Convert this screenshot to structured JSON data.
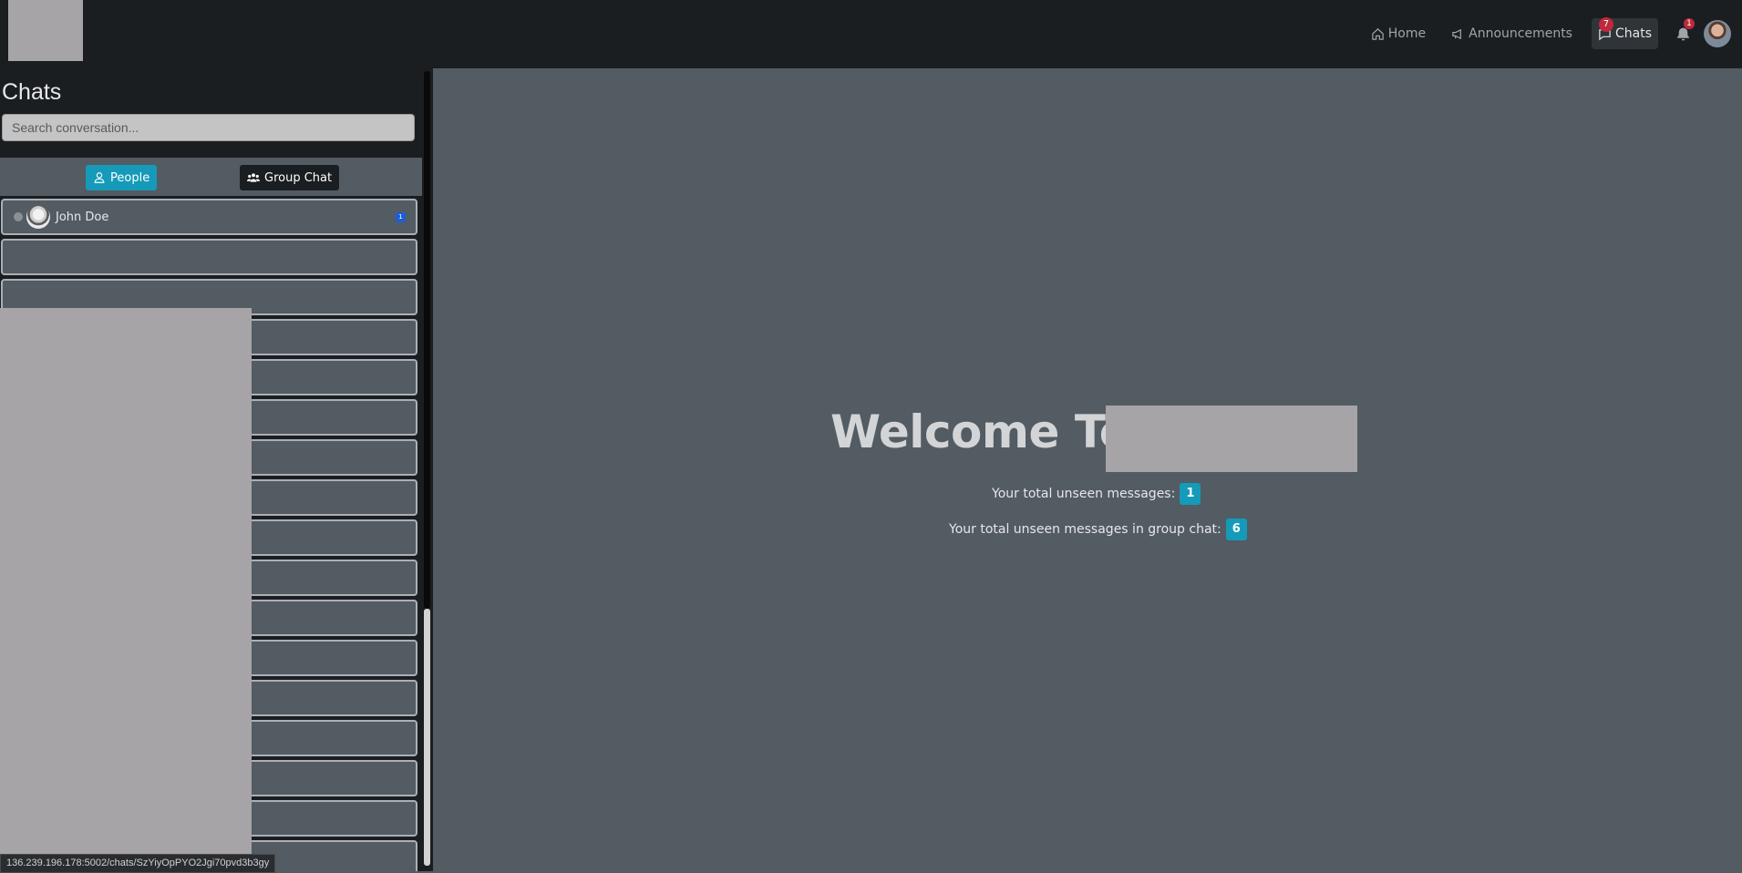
{
  "nav": {
    "home": "Home",
    "announcements": "Announcements",
    "chats": "Chats",
    "chats_badge": "7",
    "notifications_badge": "1"
  },
  "sidebar": {
    "title": "Chats",
    "search_placeholder": "Search conversation...",
    "tabs": {
      "people": "People",
      "group_chat": "Group Chat"
    },
    "contacts": [
      {
        "name": "John Doe",
        "unread": "1"
      }
    ]
  },
  "main": {
    "welcome_text": "Welcome To",
    "unseen_label": "Your total unseen messages:",
    "unseen_value": "1",
    "group_unseen_label": "Your total unseen messages in group chat:",
    "group_unseen_value": "6"
  },
  "status_bar": {
    "url": "136.239.196.178:5002/chats/SzYiyOpPYO2Jgi70pvd3b3gy"
  },
  "colors": {
    "navbar": "#1b1e21",
    "main_bg": "#535b63",
    "accent": "#159ab9",
    "badge_red": "#c0283b"
  }
}
